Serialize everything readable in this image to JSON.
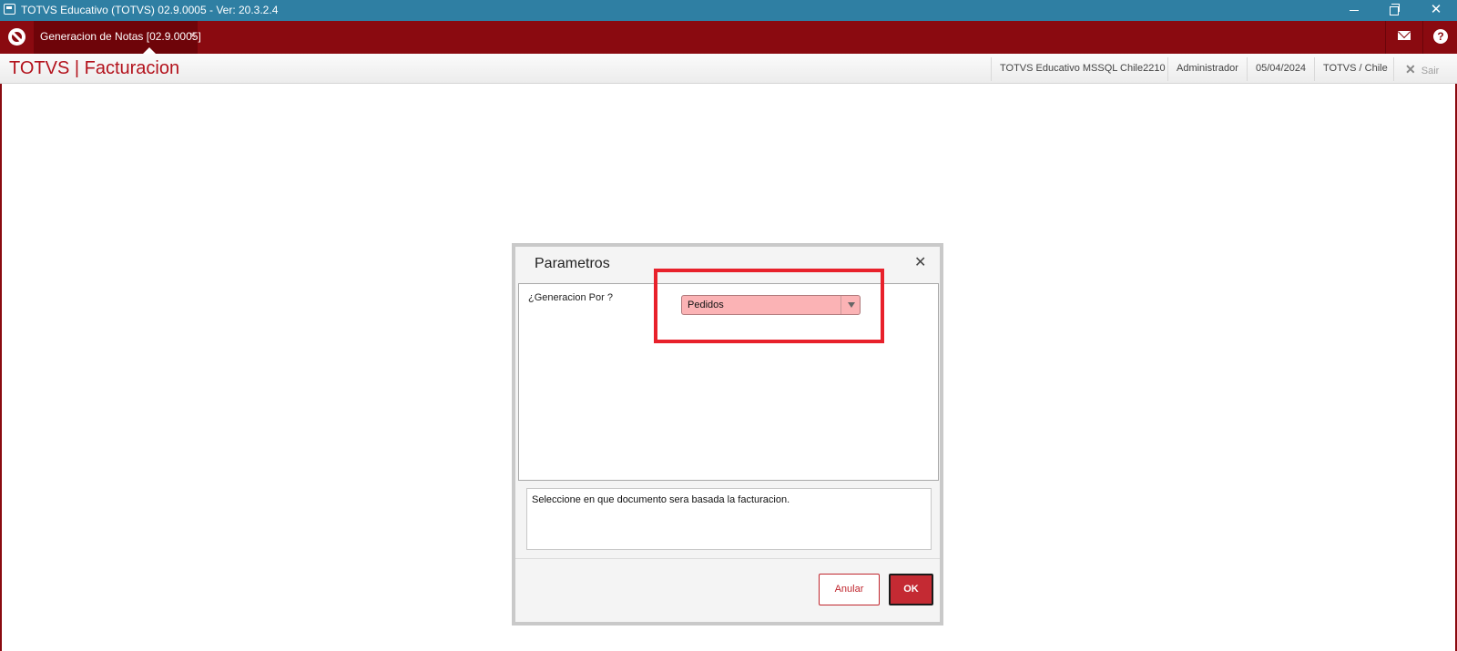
{
  "window": {
    "title": "TOTVS Educativo (TOTVS) 02.9.0005 - Ver: 20.3.2.4",
    "close_glyph": "✕"
  },
  "tabbar": {
    "active_tab": "Generacion de Notas [02.9.0005]",
    "tab_close_glyph": "×",
    "help_glyph": "?"
  },
  "header": {
    "app_title": "TOTVS | Facturacion",
    "environment": "TOTVS Educativo MSSQL Chile2210",
    "user": "Administrador",
    "date": "05/04/2024",
    "company": "TOTVS / Chile",
    "exit_label": "Sair",
    "exit_glyph": "✕"
  },
  "dialog": {
    "title": "Parametros",
    "close_glyph": "✕",
    "param_label": "¿Generacion Por ?",
    "param_value": "Pedidos",
    "description": "Seleccione en que documento sera basada la facturacion.",
    "cancel_label": "Anular",
    "ok_label": "OK"
  },
  "colors": {
    "titlebar": "#2f7fa3",
    "brand_red": "#8a0a10",
    "highlight": "#e8212b",
    "select_bg": "#fbb3b5"
  }
}
